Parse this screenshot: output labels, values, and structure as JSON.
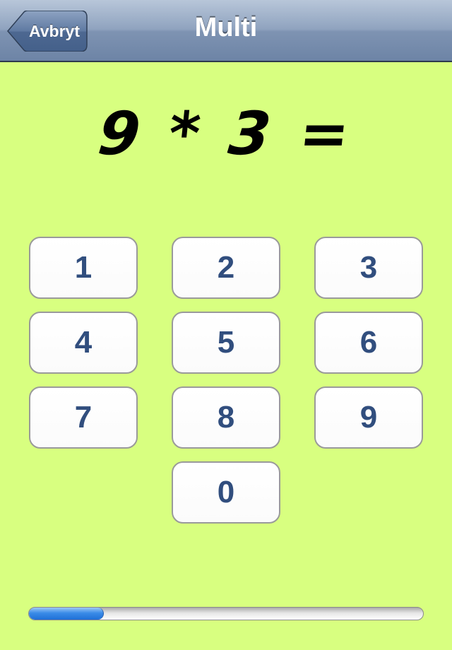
{
  "navbar": {
    "title": "Multi",
    "back_label": "Avbryt"
  },
  "question": {
    "text": "9 * 3 ="
  },
  "keypad": {
    "keys": [
      "1",
      "2",
      "3",
      "4",
      "5",
      "6",
      "7",
      "8",
      "9",
      "0"
    ]
  },
  "progress": {
    "fraction": 0.19
  },
  "colors": {
    "background": "#d8ff80",
    "key_text": "#314e7e",
    "progress_fill": "#2f7fe0"
  }
}
